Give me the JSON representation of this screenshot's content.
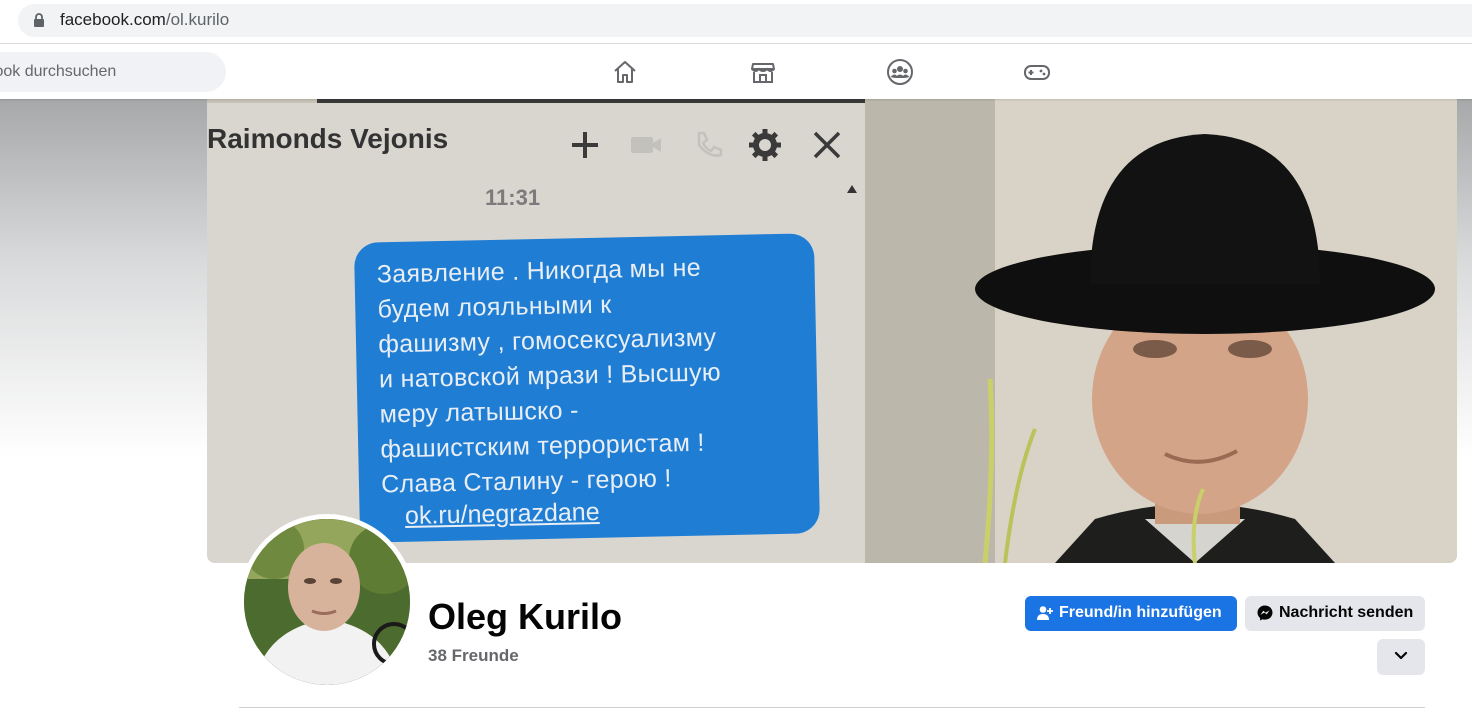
{
  "browser": {
    "url_domain": "facebook.com",
    "url_path": "/ol.kurilo"
  },
  "fb_nav": {
    "search_placeholder": "Facebook durchsuchen",
    "icons": [
      "home-icon",
      "marketplace-icon",
      "groups-icon",
      "gaming-icon"
    ]
  },
  "cover": {
    "chat_header": "Raimonds Vejonis",
    "chat_time": "11:31",
    "message_text": "Заявление . Никогда мы не\nбудем лояльными к\nфашизму , гомосексуализму\nи натовской мрази ! Высшую\nмеру латышско -\nфашистским террористам !\nСлава Сталину - герою !",
    "message_link": "ok.ru/negrazdane"
  },
  "profile": {
    "name": "Oleg Kurilo",
    "friends": "38 Freunde",
    "add_friend_label": "Freund/in hinzufügen",
    "send_message_label": "Nachricht senden"
  },
  "colors": {
    "primary_blue": "#1b74e4",
    "secondary_button": "#e4e6eb",
    "chat_bubble": "#1f7ed4"
  }
}
